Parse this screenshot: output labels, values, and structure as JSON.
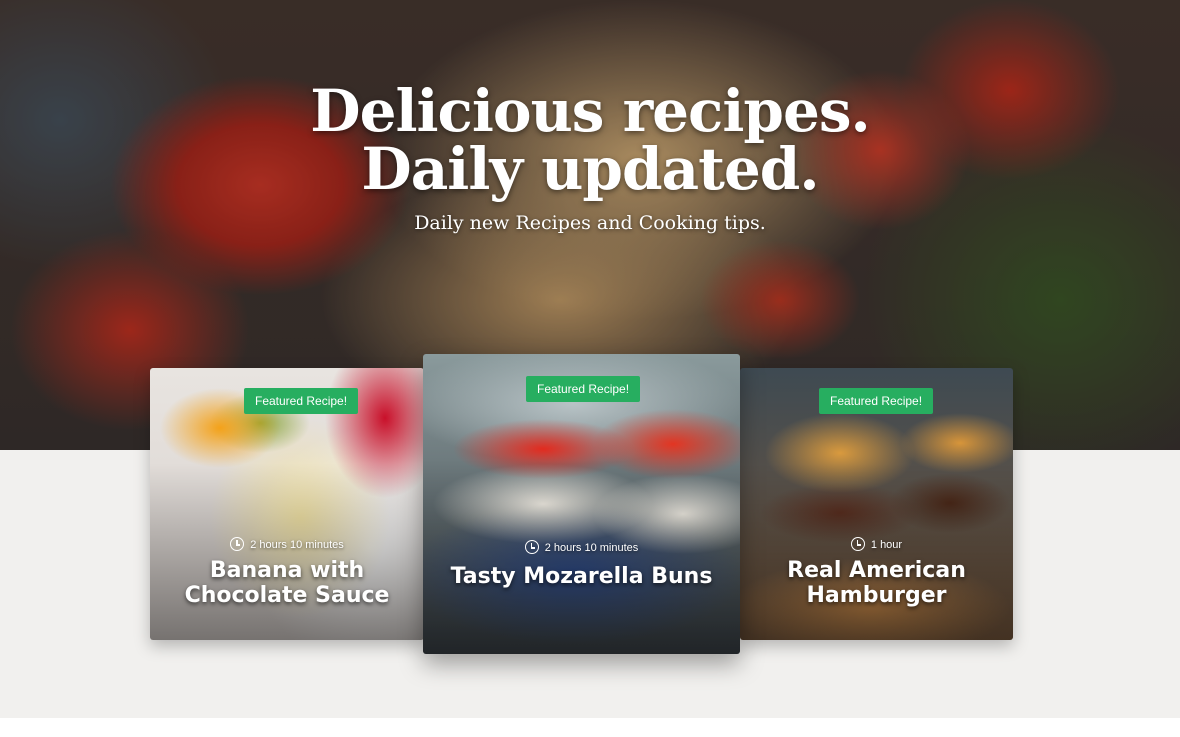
{
  "hero": {
    "title_line1": "Delicious recipes.",
    "title_line2": "Daily updated.",
    "subtitle": "Daily new Recipes and Cooking tips."
  },
  "cards": [
    {
      "badge": "Featured Recipe!",
      "time": "2 hours 10 minutes",
      "title": "Banana with Chocolate Sauce"
    },
    {
      "badge": "Featured Recipe!",
      "time": "2 hours 10 minutes",
      "title": "Tasty Mozarella Buns"
    },
    {
      "badge": "Featured Recipe!",
      "time": "1 hour",
      "title": "Real American Hamburger"
    }
  ],
  "colors": {
    "badge": "#27ae60",
    "band": "#f1f0ee"
  }
}
